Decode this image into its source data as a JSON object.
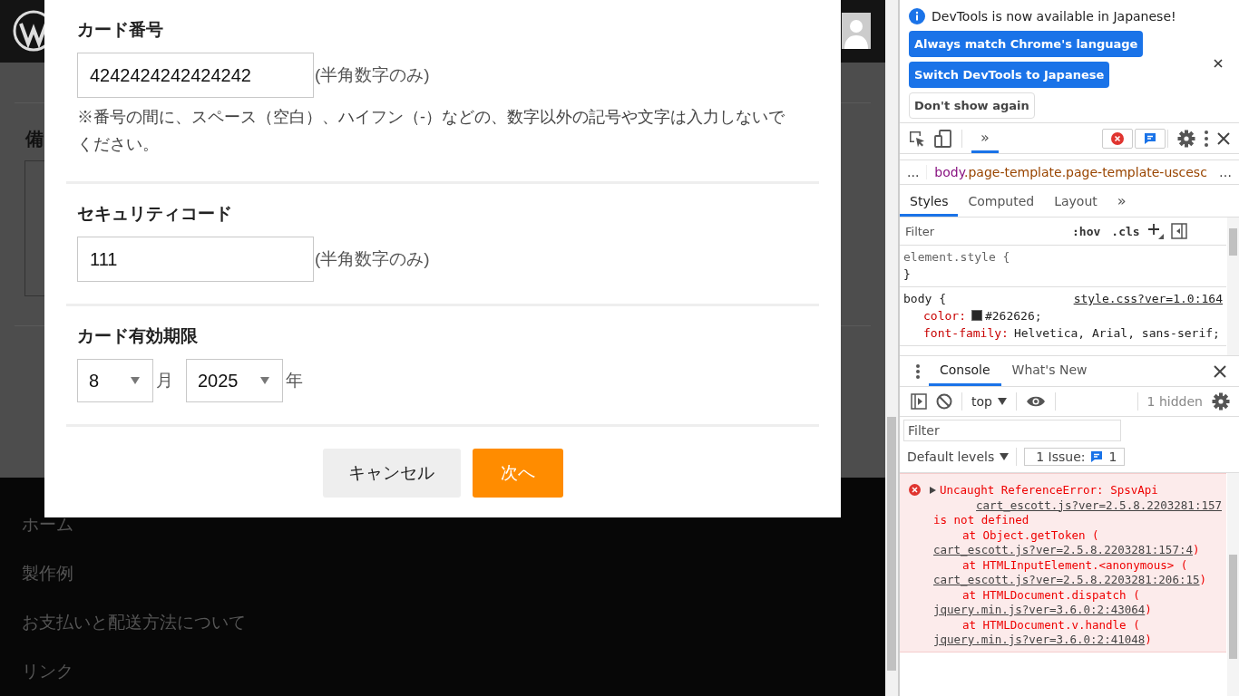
{
  "page": {
    "heading_fragment": "備",
    "footer_links": [
      "ホーム",
      "製作例",
      "お支払いと配送方法について",
      "リンク"
    ]
  },
  "modal": {
    "sections": [
      {
        "kind": "text_field",
        "label": "カード番号",
        "value": "4242424242424242",
        "hint": "(半角数字のみ)",
        "note": "※番号の間に、スペース（空白）、ハイフン（-）などの、数字以外の記号や文字は入力しないでください。"
      },
      {
        "kind": "text_field",
        "label": "セキュリティコード",
        "value": "111",
        "hint": "(半角数字のみ)"
      },
      {
        "kind": "expiry",
        "label": "カード有効期限",
        "month": "8",
        "month_unit": "月",
        "year": "2025",
        "year_unit": "年"
      }
    ],
    "buttons": [
      {
        "kind": "secondary",
        "label": "キャンセル"
      },
      {
        "kind": "primary",
        "label": "次へ"
      }
    ]
  },
  "devtools": {
    "infobar": {
      "message": "DevTools is now available in Japanese!",
      "buttons": [
        {
          "kind": "primary",
          "label": "Always match Chrome's language"
        },
        {
          "kind": "primary",
          "label": "Switch DevTools to Japanese"
        },
        {
          "kind": "plain",
          "label": "Don't show again"
        }
      ]
    },
    "main_tabs": [
      {
        "label": "»",
        "selected": true
      }
    ],
    "breadcrumb": {
      "left_more": "...",
      "tag": "body",
      "classes": ".page-template.page-template-uscesc",
      "right_more": "…"
    },
    "panel_tabs": [
      {
        "label": "Styles",
        "selected": true
      },
      {
        "label": "Computed",
        "selected": false
      },
      {
        "label": "Layout",
        "selected": false
      }
    ],
    "panel_more": "»",
    "styles": {
      "filter_placeholder": "Filter",
      "hov": ":hov",
      "cls": ".cls",
      "rules": [
        {
          "selector": "element.style {",
          "kind": "inline",
          "close": "}"
        },
        {
          "selector": "body {",
          "kind": "sheet",
          "source": "style.css?ver=1.0:164",
          "declarations": [
            {
              "property": "color:",
              "value": "#262626;",
              "color_swatch": true
            },
            {
              "property": "font-family:",
              "value": "Helvetica, Arial, sans-serif;"
            }
          ]
        }
      ]
    },
    "drawer_tabs": [
      {
        "label": "Console",
        "selected": true
      },
      {
        "label": "What's New",
        "selected": false
      }
    ],
    "console": {
      "context": "top",
      "hidden": "1 hidden",
      "filter_placeholder": "Filter",
      "levels": "Default levels",
      "issues_label": "1 Issue:",
      "issues_count": "1",
      "messages": [
        {
          "kind": "error",
          "text": "Uncaught ReferenceError: SpsvApi",
          "source": "cart_escott.js?ver=2.5.8.2203281:157",
          "continuation": "is not defined",
          "stack": [
            {
              "prefix": "at Object.getToken (",
              "link": "cart_escott.js?ver=2.5.8.2203281:157:4",
              "suffix": ")"
            },
            {
              "prefix": "at HTMLInputElement.<anonymous> (",
              "link": "cart_escott.js?ver=2.5.8.2203281:206:15",
              "suffix": ")"
            },
            {
              "prefix": "at HTMLDocument.dispatch (",
              "link": "jquery.min.js?ver=3.6.0:2:43064",
              "suffix": ")"
            },
            {
              "prefix": "at HTMLDocument.v.handle (",
              "link": "jquery.min.js?ver=3.6.0:2:41048",
              "suffix": ")"
            }
          ]
        }
      ]
    }
  }
}
